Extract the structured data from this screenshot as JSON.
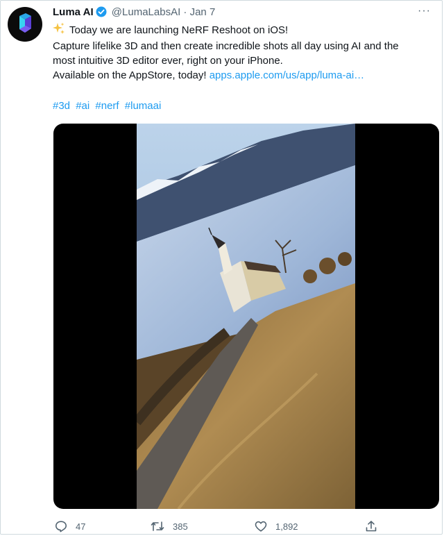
{
  "author": {
    "name": "Luma AI",
    "handle": "@LumaLabsAI",
    "separator": "·",
    "date": "Jan 7"
  },
  "tweet": {
    "lines": [
      "Today we are launching NeRF Reshoot on iOS!",
      "Capture lifelike 3D and then create incredible shots all day using AI and the",
      "most intuitive 3D editor ever, right on your iPhone."
    ],
    "line4_text": "Available on the AppStore, today! ",
    "link": "apps.apple.com/us/app/luma-ai…",
    "hashtags": [
      "#3d",
      "#ai",
      "#nerf",
      "#lumaai"
    ]
  },
  "more_menu": "···",
  "actions": {
    "replies": "47",
    "retweets": "385",
    "likes": "1,892"
  },
  "colors": {
    "link": "#1d9bf0",
    "verified": "#1d9bf0",
    "sparkle": "#f5c242"
  },
  "icons": [
    "logo-icon",
    "verified-badge-icon",
    "sparkles-icon",
    "reply-icon",
    "retweet-icon",
    "like-icon",
    "share-icon",
    "more-icon"
  ]
}
